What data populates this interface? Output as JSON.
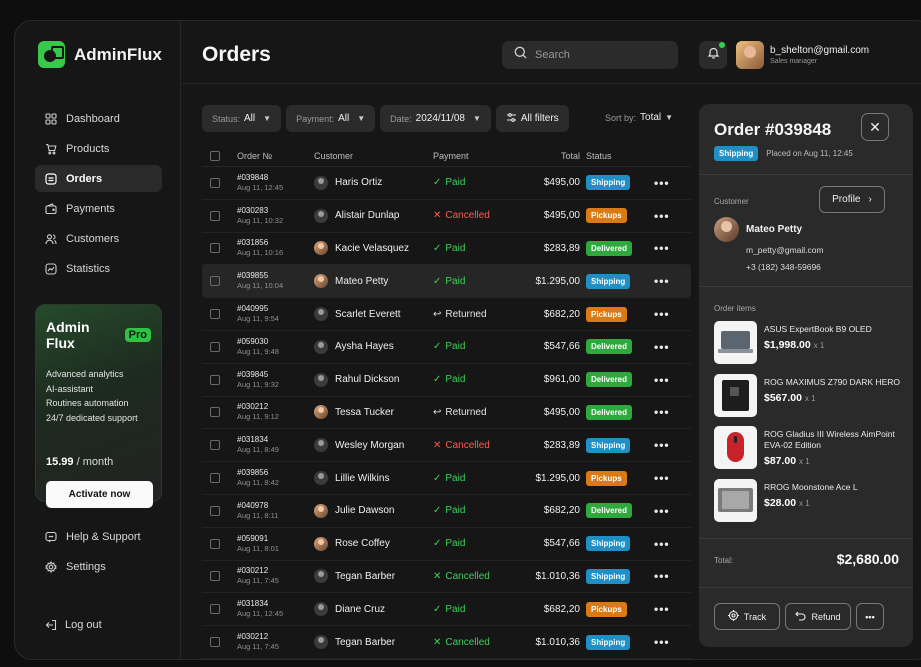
{
  "app": {
    "name": "AdminFlux"
  },
  "sidebar": {
    "nav": [
      {
        "label": "Dashboard",
        "icon": "grid-icon"
      },
      {
        "label": "Products",
        "icon": "cart-icon"
      },
      {
        "label": "Orders",
        "icon": "orders-icon",
        "active": true
      },
      {
        "label": "Payments",
        "icon": "wallet-icon"
      },
      {
        "label": "Customers",
        "icon": "users-icon"
      },
      {
        "label": "Statistics",
        "icon": "chart-icon"
      }
    ],
    "promo": {
      "title": "Admin Flux",
      "badge": "Pro",
      "features": [
        "Advanced analytics",
        "AI-assistant",
        "Routines automation",
        "24/7 dedicated support"
      ],
      "price": "15.99",
      "period": " / month",
      "cta": "Activate now"
    },
    "bottom": [
      {
        "label": "Help & Support",
        "icon": "help-icon"
      },
      {
        "label": "Settings",
        "icon": "gear-icon"
      }
    ],
    "logout": "Log out"
  },
  "header": {
    "title": "Orders",
    "search_placeholder": "Search",
    "user": {
      "email": "b_shelton@gmail.com",
      "role": "Sales manager"
    }
  },
  "filters": {
    "status": {
      "key": "Status:",
      "value": "All"
    },
    "payment": {
      "key": "Payment:",
      "value": "All"
    },
    "date": {
      "key": "Date:",
      "value": "2024/11/08"
    },
    "all_filters": "All filters",
    "sort_key": "Sort by:",
    "sort_value": "Total"
  },
  "table": {
    "columns": [
      "Order №",
      "Customer",
      "Payment",
      "Total",
      "Status"
    ],
    "rows": [
      {
        "id": "#039848",
        "date": "Aug 11, 12:45",
        "customer": "Haris Ortiz",
        "avatar": "default",
        "payment": "Paid",
        "total": "$495,00",
        "status": "Shipping"
      },
      {
        "id": "#030283",
        "date": "Aug 11, 10:32",
        "customer": "Alistair Dunlap",
        "avatar": "default",
        "payment": "Cancelled",
        "total": "$495,00",
        "status": "Pickups"
      },
      {
        "id": "#031856",
        "date": "Aug 11, 10:16",
        "customer": "Kacie Velasquez",
        "avatar": "photo",
        "payment": "Paid",
        "total": "$283,89",
        "status": "Delivered"
      },
      {
        "id": "#039855",
        "date": "Aug 11, 10:04",
        "customer": "Mateo Petty",
        "avatar": "photo",
        "payment": "Paid",
        "total": "$1.295,00",
        "status": "Shipping",
        "selected": true
      },
      {
        "id": "#040995",
        "date": "Aug 11, 9:54",
        "customer": "Scarlet Everett",
        "avatar": "default",
        "payment": "Returned",
        "total": "$682,20",
        "status": "Pickups"
      },
      {
        "id": "#059030",
        "date": "Aug 11, 9:48",
        "customer": "Aysha Hayes",
        "avatar": "default",
        "payment": "Paid",
        "total": "$547,66",
        "status": "Delivered"
      },
      {
        "id": "#039845",
        "date": "Aug 11, 9:32",
        "customer": "Rahul Dickson",
        "avatar": "default",
        "payment": "Paid",
        "total": "$961,00",
        "status": "Delivered"
      },
      {
        "id": "#030212",
        "date": "Aug 11, 9:12",
        "customer": "Tessa Tucker",
        "avatar": "photo",
        "payment": "Returned",
        "total": "$495,00",
        "status": "Delivered"
      },
      {
        "id": "#031834",
        "date": "Aug 11, 8:49",
        "customer": "Wesley Morgan",
        "avatar": "default",
        "payment": "Cancelled",
        "total": "$283,89",
        "status": "Shipping"
      },
      {
        "id": "#039856",
        "date": "Aug 11, 8:42",
        "customer": "Lillie Wilkins",
        "avatar": "default",
        "payment": "Paid",
        "total": "$1.295,00",
        "status": "Pickups"
      },
      {
        "id": "#040978",
        "date": "Aug 11, 8:11",
        "customer": "Julie Dawson",
        "avatar": "photo",
        "payment": "Paid",
        "total": "$682,20",
        "status": "Delivered"
      },
      {
        "id": "#059091",
        "date": "Aug 11, 8:01",
        "customer": "Rose Coffey",
        "avatar": "photo",
        "payment": "Paid",
        "total": "$547,66",
        "status": "Shipping"
      },
      {
        "id": "#030212",
        "date": "Aug 11, 7:45",
        "customer": "Tegan Barber",
        "avatar": "default",
        "payment": "Cancelled",
        "total": "$1.010,36",
        "status": "Shipping"
      },
      {
        "id": "#031834",
        "date": "Aug 11, 12:45",
        "customer": "Diane Cruz",
        "avatar": "default",
        "payment": "Paid",
        "total": "$682,20",
        "status": "Pickups"
      },
      {
        "id": "#030212",
        "date": "Aug 11, 7:45",
        "customer": "Tegan Barber",
        "avatar": "default",
        "payment": "Cancelled",
        "total": "$1.010,36",
        "status": "Shipping"
      }
    ]
  },
  "detail": {
    "title": "Order #039848",
    "status": "Shipping",
    "placed": "Placed on Aug 11, 12:45",
    "customer_label": "Customer",
    "profile_label": "Profile",
    "customer": {
      "name": "Mateo Petty",
      "email": "m_petty@gmail.com",
      "phone": "+3 (182) 348-59696"
    },
    "items_label": "Order items",
    "items": [
      {
        "name": "ASUS ExpertBook B9 OLED",
        "price": "$1,998.00",
        "qty": "x 1"
      },
      {
        "name": "ROG MAXIMUS Z790 DARK HERO",
        "price": "$567.00",
        "qty": "x 1"
      },
      {
        "name": "ROG Gladius III Wireless AimPoint EVA-02 Edition",
        "price": "$87.00",
        "qty": "x 1"
      },
      {
        "name": "RROG Moonstone Ace L",
        "price": "$28.00",
        "qty": "x 1"
      }
    ],
    "total_label": "Total:",
    "total": "$2,680.00",
    "actions": {
      "track": "Track",
      "refund": "Refund"
    }
  },
  "colors": {
    "accent": "#38c94a",
    "shipping": "#1f8fc5",
    "pickups": "#d97a14",
    "delivered": "#2fa83e",
    "paid": "#3fcf5a",
    "cancelled": "#ff5a4c"
  }
}
